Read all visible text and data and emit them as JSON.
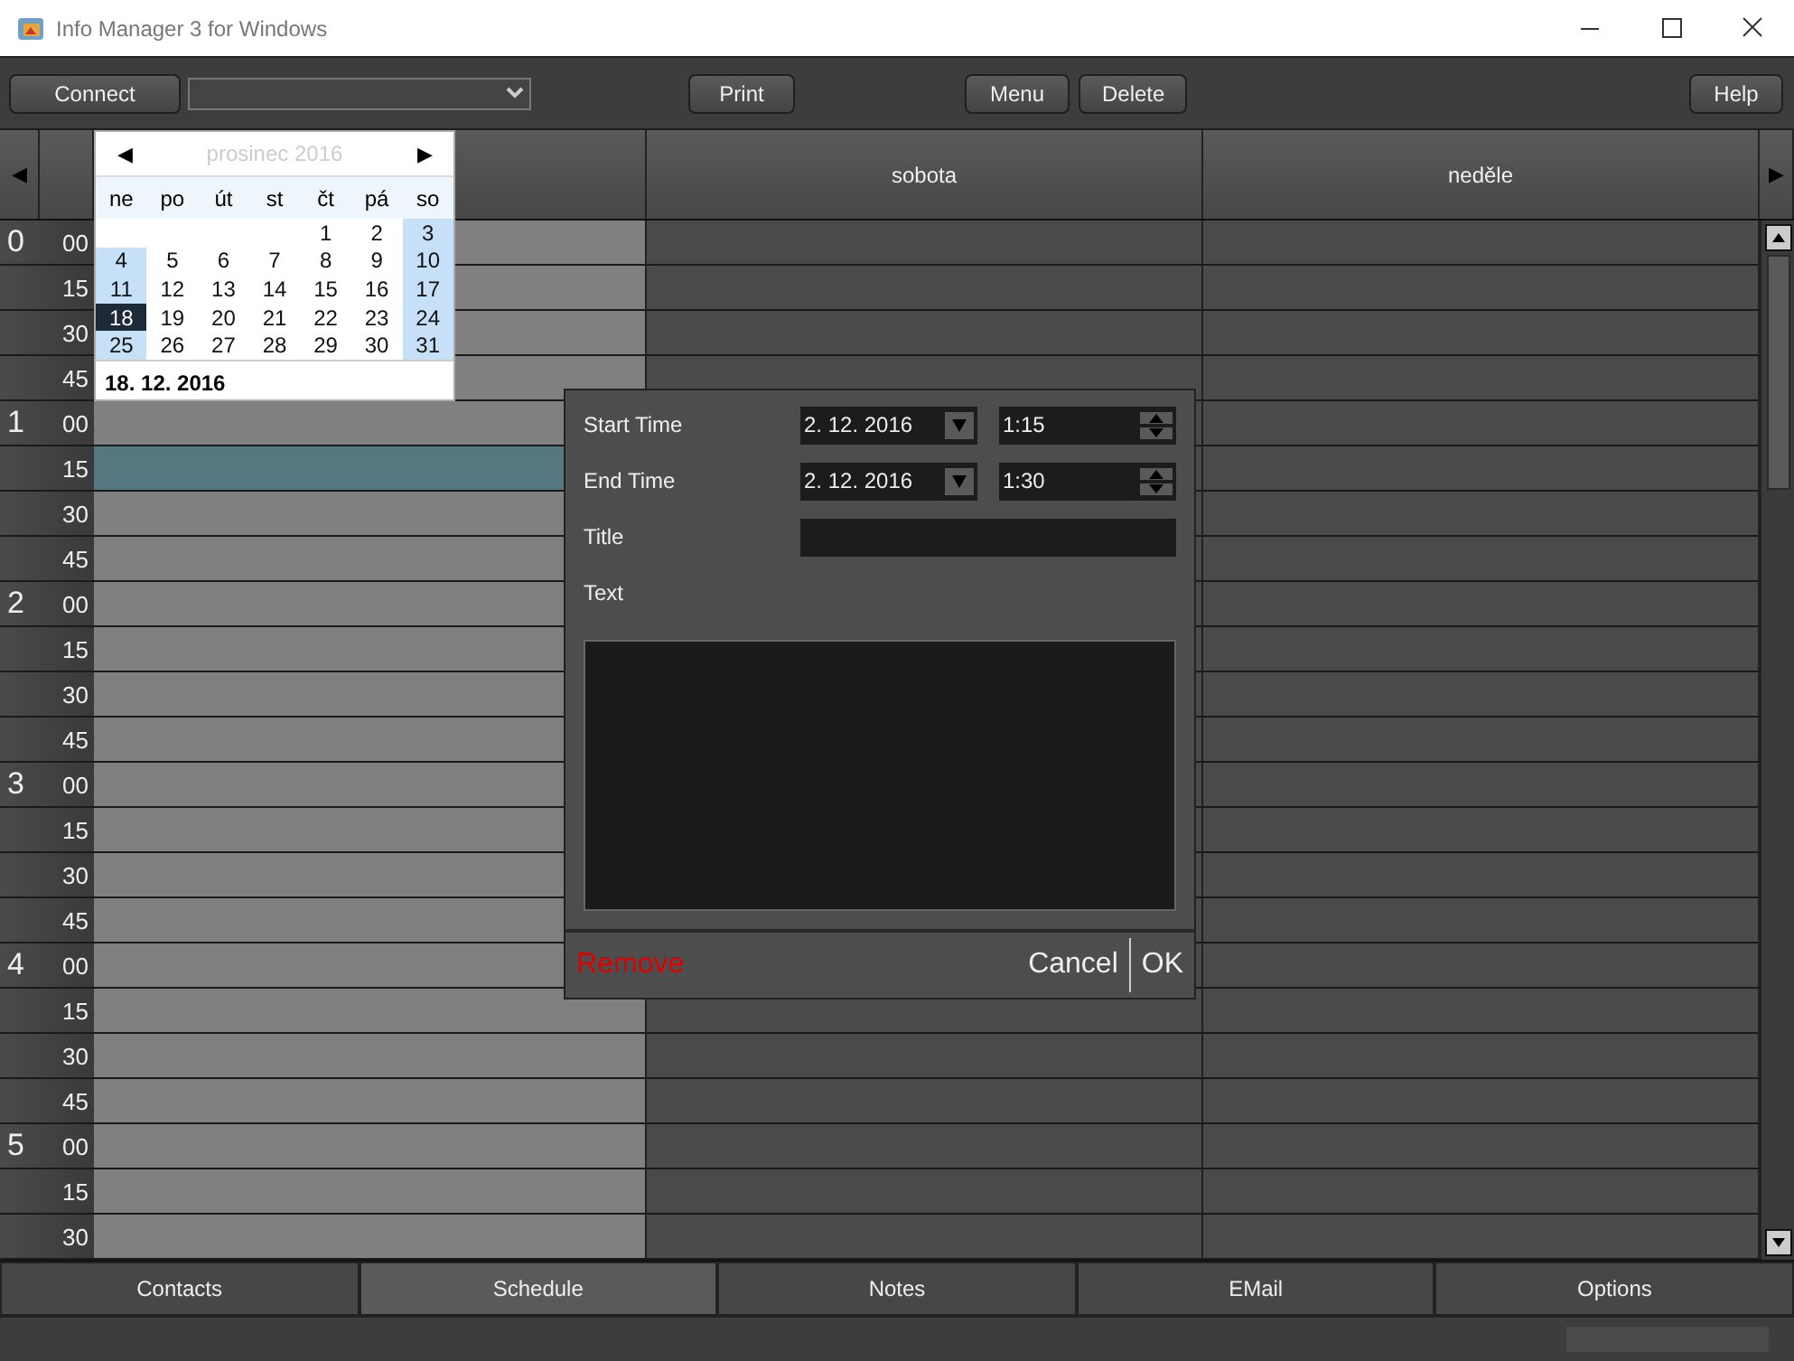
{
  "window": {
    "title": "Info Manager 3 for Windows"
  },
  "toolbar": [
    {
      "kind": "button",
      "label": "Connect"
    },
    {
      "kind": "dropdown"
    },
    {
      "kind": "button",
      "label": "Print"
    },
    {
      "kind": "button",
      "label": "Menu"
    },
    {
      "kind": "button",
      "label": "Delete"
    },
    {
      "kind": "button",
      "label": "Help"
    }
  ],
  "schedule": {
    "prev": "◀",
    "next": "▶",
    "columns": [
      {
        "highlighted": true
      },
      {
        "label": "sobota",
        "highlighted": false
      },
      {
        "label": "neděle",
        "highlighted": false
      }
    ],
    "hours": [
      {
        "hour": "0",
        "slots": [
          {
            "minute": "00",
            "selected": false
          },
          {
            "minute": "15",
            "selected": false
          },
          {
            "minute": "30",
            "selected": false
          },
          {
            "minute": "45",
            "selected": false
          }
        ]
      },
      {
        "hour": "1",
        "slots": [
          {
            "minute": "00",
            "selected": false
          },
          {
            "minute": "15",
            "selected": true
          },
          {
            "minute": "30",
            "selected": false
          },
          {
            "minute": "45",
            "selected": false
          }
        ]
      },
      {
        "hour": "2",
        "slots": [
          {
            "minute": "00",
            "selected": false
          },
          {
            "minute": "15",
            "selected": false
          },
          {
            "minute": "30",
            "selected": false
          },
          {
            "minute": "45",
            "selected": false
          }
        ]
      },
      {
        "hour": "3",
        "slots": [
          {
            "minute": "00",
            "selected": false
          },
          {
            "minute": "15",
            "selected": false
          },
          {
            "minute": "30",
            "selected": false
          },
          {
            "minute": "45",
            "selected": false
          }
        ]
      },
      {
        "hour": "4",
        "slots": [
          {
            "minute": "00",
            "selected": false
          },
          {
            "minute": "15",
            "selected": false
          },
          {
            "minute": "30",
            "selected": false
          },
          {
            "minute": "45",
            "selected": false
          }
        ]
      },
      {
        "hour": "5",
        "slots": [
          {
            "minute": "00",
            "selected": false
          },
          {
            "minute": "15",
            "selected": false
          },
          {
            "minute": "30",
            "selected": false
          }
        ]
      }
    ]
  },
  "calendar": {
    "prev": "◀",
    "next": "▶",
    "month": "prosinec 2016",
    "weekdays": [
      "ne",
      "po",
      "út",
      "st",
      "čt",
      "pá",
      "so"
    ],
    "weeks": [
      [
        {
          "kind": "blank"
        },
        {
          "kind": "blank"
        },
        {
          "kind": "blank"
        },
        {
          "kind": "blank"
        },
        {
          "kind": "day",
          "day": "1",
          "weekend": false,
          "selected": false
        },
        {
          "kind": "day",
          "day": "2",
          "weekend": false,
          "selected": false
        },
        {
          "kind": "day",
          "day": "3",
          "weekend": true,
          "selected": false
        }
      ],
      [
        {
          "kind": "day",
          "day": "4",
          "weekend": true,
          "selected": false
        },
        {
          "kind": "day",
          "day": "5",
          "weekend": false,
          "selected": false
        },
        {
          "kind": "day",
          "day": "6",
          "weekend": false,
          "selected": false
        },
        {
          "kind": "day",
          "day": "7",
          "weekend": false,
          "selected": false
        },
        {
          "kind": "day",
          "day": "8",
          "weekend": false,
          "selected": false
        },
        {
          "kind": "day",
          "day": "9",
          "weekend": false,
          "selected": false
        },
        {
          "kind": "day",
          "day": "10",
          "weekend": true,
          "selected": false
        }
      ],
      [
        {
          "kind": "day",
          "day": "11",
          "weekend": true,
          "selected": false
        },
        {
          "kind": "day",
          "day": "12",
          "weekend": false,
          "selected": false
        },
        {
          "kind": "day",
          "day": "13",
          "weekend": false,
          "selected": false
        },
        {
          "kind": "day",
          "day": "14",
          "weekend": false,
          "selected": false
        },
        {
          "kind": "day",
          "day": "15",
          "weekend": false,
          "selected": false
        },
        {
          "kind": "day",
          "day": "16",
          "weekend": false,
          "selected": false
        },
        {
          "kind": "day",
          "day": "17",
          "weekend": true,
          "selected": false
        }
      ],
      [
        {
          "kind": "day",
          "day": "18",
          "weekend": true,
          "selected": true
        },
        {
          "kind": "day",
          "day": "19",
          "weekend": false,
          "selected": false
        },
        {
          "kind": "day",
          "day": "20",
          "weekend": false,
          "selected": false
        },
        {
          "kind": "day",
          "day": "21",
          "weekend": false,
          "selected": false
        },
        {
          "kind": "day",
          "day": "22",
          "weekend": false,
          "selected": false
        },
        {
          "kind": "day",
          "day": "23",
          "weekend": false,
          "selected": false
        },
        {
          "kind": "day",
          "day": "24",
          "weekend": true,
          "selected": false
        }
      ],
      [
        {
          "kind": "day",
          "day": "25",
          "weekend": true,
          "selected": false
        },
        {
          "kind": "day",
          "day": "26",
          "weekend": false,
          "selected": false
        },
        {
          "kind": "day",
          "day": "27",
          "weekend": false,
          "selected": false
        },
        {
          "kind": "day",
          "day": "28",
          "weekend": false,
          "selected": false
        },
        {
          "kind": "day",
          "day": "29",
          "weekend": false,
          "selected": false
        },
        {
          "kind": "day",
          "day": "30",
          "weekend": false,
          "selected": false
        },
        {
          "kind": "day",
          "day": "31",
          "weekend": true,
          "selected": false
        }
      ]
    ],
    "today": "18. 12. 2016"
  },
  "dialog": {
    "start_time": {
      "label": "Start Time",
      "date": "2. 12. 2016",
      "time": "1:15"
    },
    "end_time": {
      "label": "End Time",
      "date": "2. 12. 2016",
      "time": "1:30"
    },
    "title": {
      "label": "Title"
    },
    "text": {
      "label": "Text"
    },
    "buttons": {
      "remove": "Remove",
      "cancel": "Cancel",
      "ok": "OK"
    }
  },
  "tabs": [
    {
      "label": "Contacts",
      "selected": false
    },
    {
      "label": "Schedule",
      "selected": true
    },
    {
      "label": "Notes",
      "selected": false
    },
    {
      "label": "EMail",
      "selected": false
    },
    {
      "label": "Options",
      "selected": false
    }
  ]
}
